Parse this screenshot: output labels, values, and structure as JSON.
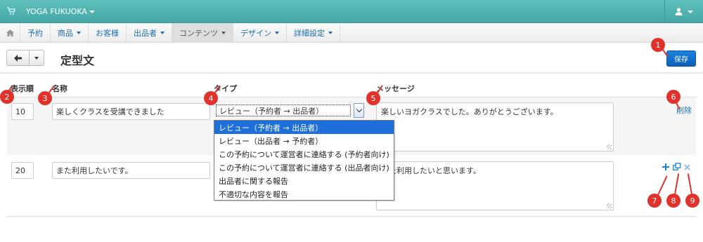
{
  "topbar": {
    "brand": "YOGA FUKUOKA",
    "cart_icon": "cart-icon",
    "user_icon": "user-icon"
  },
  "nav": [
    {
      "label": "予約",
      "has_caret": false
    },
    {
      "label": "商品",
      "has_caret": true
    },
    {
      "label": "お客様",
      "has_caret": false
    },
    {
      "label": "出品者",
      "has_caret": true
    },
    {
      "label": "コンテンツ",
      "has_caret": true,
      "active": true
    },
    {
      "label": "デザイン",
      "has_caret": true
    },
    {
      "label": "詳細設定",
      "has_caret": true
    }
  ],
  "header": {
    "title": "定型文",
    "save_label": "保存"
  },
  "columns": {
    "order": "表示順",
    "name": "名称",
    "type": "タイプ",
    "message": "メッセージ"
  },
  "rows": [
    {
      "order": "10",
      "name": "楽しくクラスを受講できました",
      "type": "レビュー（予約者 → 出品者）",
      "message": "楽しいヨガクラスでした。ありがとうございます。",
      "delete_label": "削除"
    },
    {
      "order": "20",
      "name": "また利用したいです。",
      "type": "",
      "message": "また利用したいと思います。"
    }
  ],
  "type_options": [
    "レビュー（予約者 → 出品者）",
    "レビュー（出品者 → 予約者）",
    "この予約について運営者に連絡する (予約者向け)",
    "この予約について運営者に連絡する (出品者向け)",
    "出品者に関する報告",
    "不適切な内容を報告"
  ],
  "row_actions": {
    "add_icon": "plus-icon",
    "copy_icon": "copy-icon",
    "remove_icon": "close-icon"
  },
  "callouts": [
    "1",
    "2",
    "3",
    "4",
    "5",
    "6",
    "7",
    "8",
    "9"
  ],
  "colors": {
    "topbar": "#4fb3af",
    "link": "#1a6fb5",
    "primary": "#0d6cc9",
    "callout": "#e0312b",
    "selected": "#1e6fd9"
  }
}
